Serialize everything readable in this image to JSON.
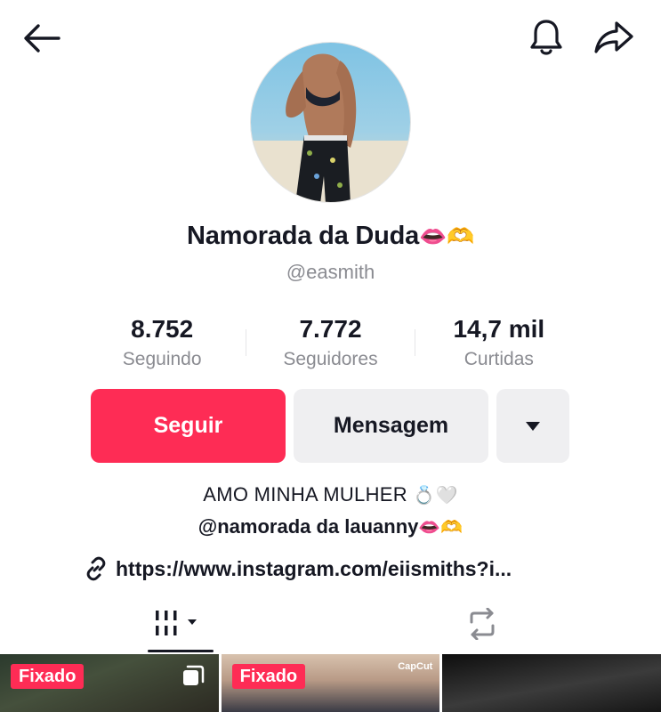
{
  "header": {
    "back_icon": "arrow-left-icon",
    "bell_icon": "bell-icon",
    "share_icon": "share-arrow-icon"
  },
  "profile": {
    "display_name": "Namorada da Duda",
    "name_emojis": "👄🫶",
    "username": "@easmith"
  },
  "stats": [
    {
      "value": "8.752",
      "label": "Seguindo"
    },
    {
      "value": "7.772",
      "label": "Seguidores"
    },
    {
      "value": "14,7 mil",
      "label": "Curtidas"
    }
  ],
  "actions": {
    "follow_label": "Seguir",
    "message_label": "Mensagem",
    "more_icon": "caret-down-icon"
  },
  "bio": {
    "line1": "AMO MINHA MULHER",
    "line1_emojis": "💍🤍",
    "mention": "@namorada da lauanny",
    "mention_emojis": "👄🫶",
    "link_icon": "link-icon",
    "link": "https://www.instagram.com/eiismiths?i..."
  },
  "tabs": [
    {
      "icon": "videos-grid-icon",
      "active": true
    },
    {
      "icon": "repost-icon",
      "active": false
    }
  ],
  "videos": [
    {
      "badge": "Fixado",
      "overlay_icon": "multi-photo-icon"
    },
    {
      "badge": "Fixado",
      "overlay_text": "CapCut"
    },
    {
      "badge": ""
    }
  ],
  "colors": {
    "accent": "#fe2c55",
    "secondary_button": "#efeff1",
    "muted_text": "#8a8b91"
  }
}
